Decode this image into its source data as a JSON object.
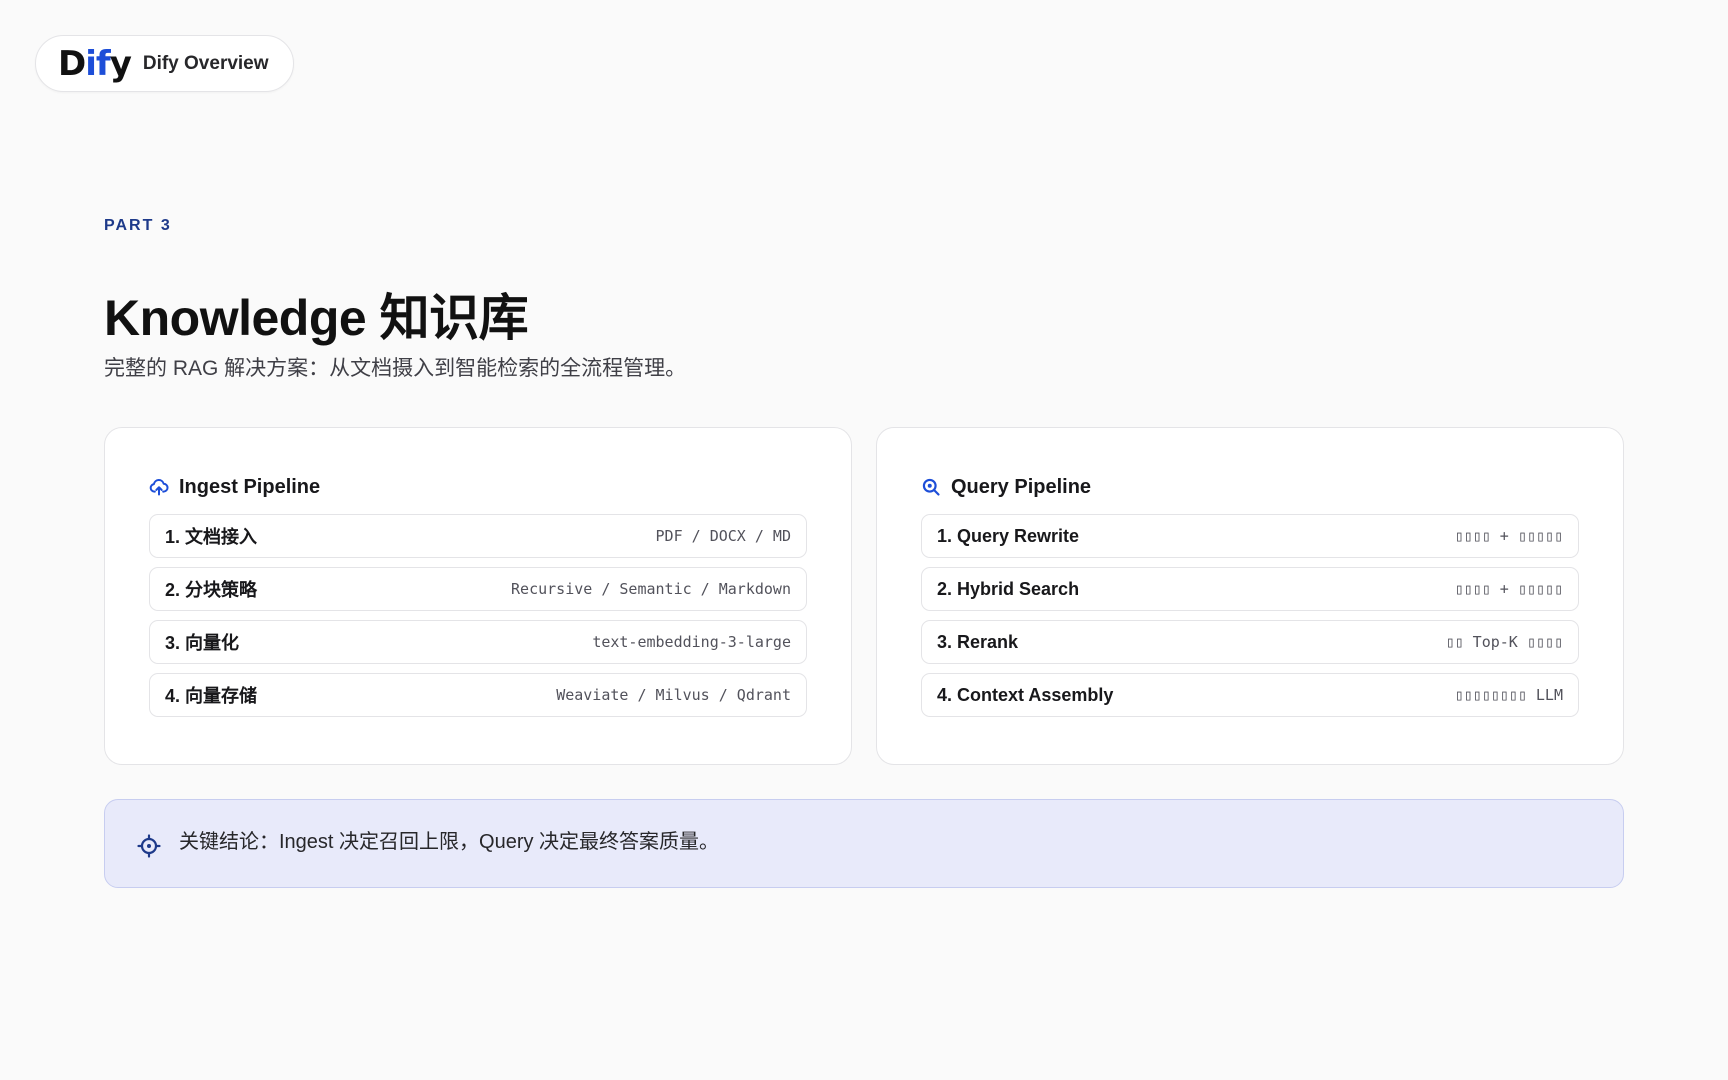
{
  "brand": {
    "logo_prefix": "D",
    "logo_accent": "if",
    "logo_suffix": "y",
    "name": "Dify Overview"
  },
  "section": {
    "label": "PART 3",
    "title": "Knowledge 知识库",
    "subtitle": "完整的 RAG 解决方案：从文档摄入到智能检索的全流程管理。"
  },
  "ingest": {
    "icon": "cloud-upload-icon",
    "title": "Ingest Pipeline",
    "steps": [
      {
        "label": "1. 文档接入",
        "detail": "PDF / DOCX / MD"
      },
      {
        "label": "2. 分块策略",
        "detail": "Recursive / Semantic / Markdown"
      },
      {
        "label": "3. 向量化",
        "detail": "text-embedding-3-large"
      },
      {
        "label": "4. 向量存储",
        "detail": "Weaviate / Milvus / Qdrant"
      }
    ]
  },
  "query": {
    "icon": "search-zoom-icon",
    "title": "Query Pipeline",
    "steps": [
      {
        "label": "1. Query Rewrite",
        "detail": "▯▯▯▯ + ▯▯▯▯▯"
      },
      {
        "label": "2. Hybrid Search",
        "detail": "▯▯▯▯ + ▯▯▯▯▯"
      },
      {
        "label": "3. Rerank",
        "detail": "▯▯ Top-K ▯▯▯▯"
      },
      {
        "label": "4. Context Assembly",
        "detail": "▯▯▯▯▯▯▯▯ LLM"
      }
    ]
  },
  "conclusion": {
    "icon": "crosshair-icon",
    "text": "关键结论：Ingest 决定召回上限，Query 决定最终答案质量。"
  },
  "colors": {
    "accent": "#1d4ed8",
    "label": "#1e3a8a",
    "callout_bg": "#e8eafa"
  }
}
